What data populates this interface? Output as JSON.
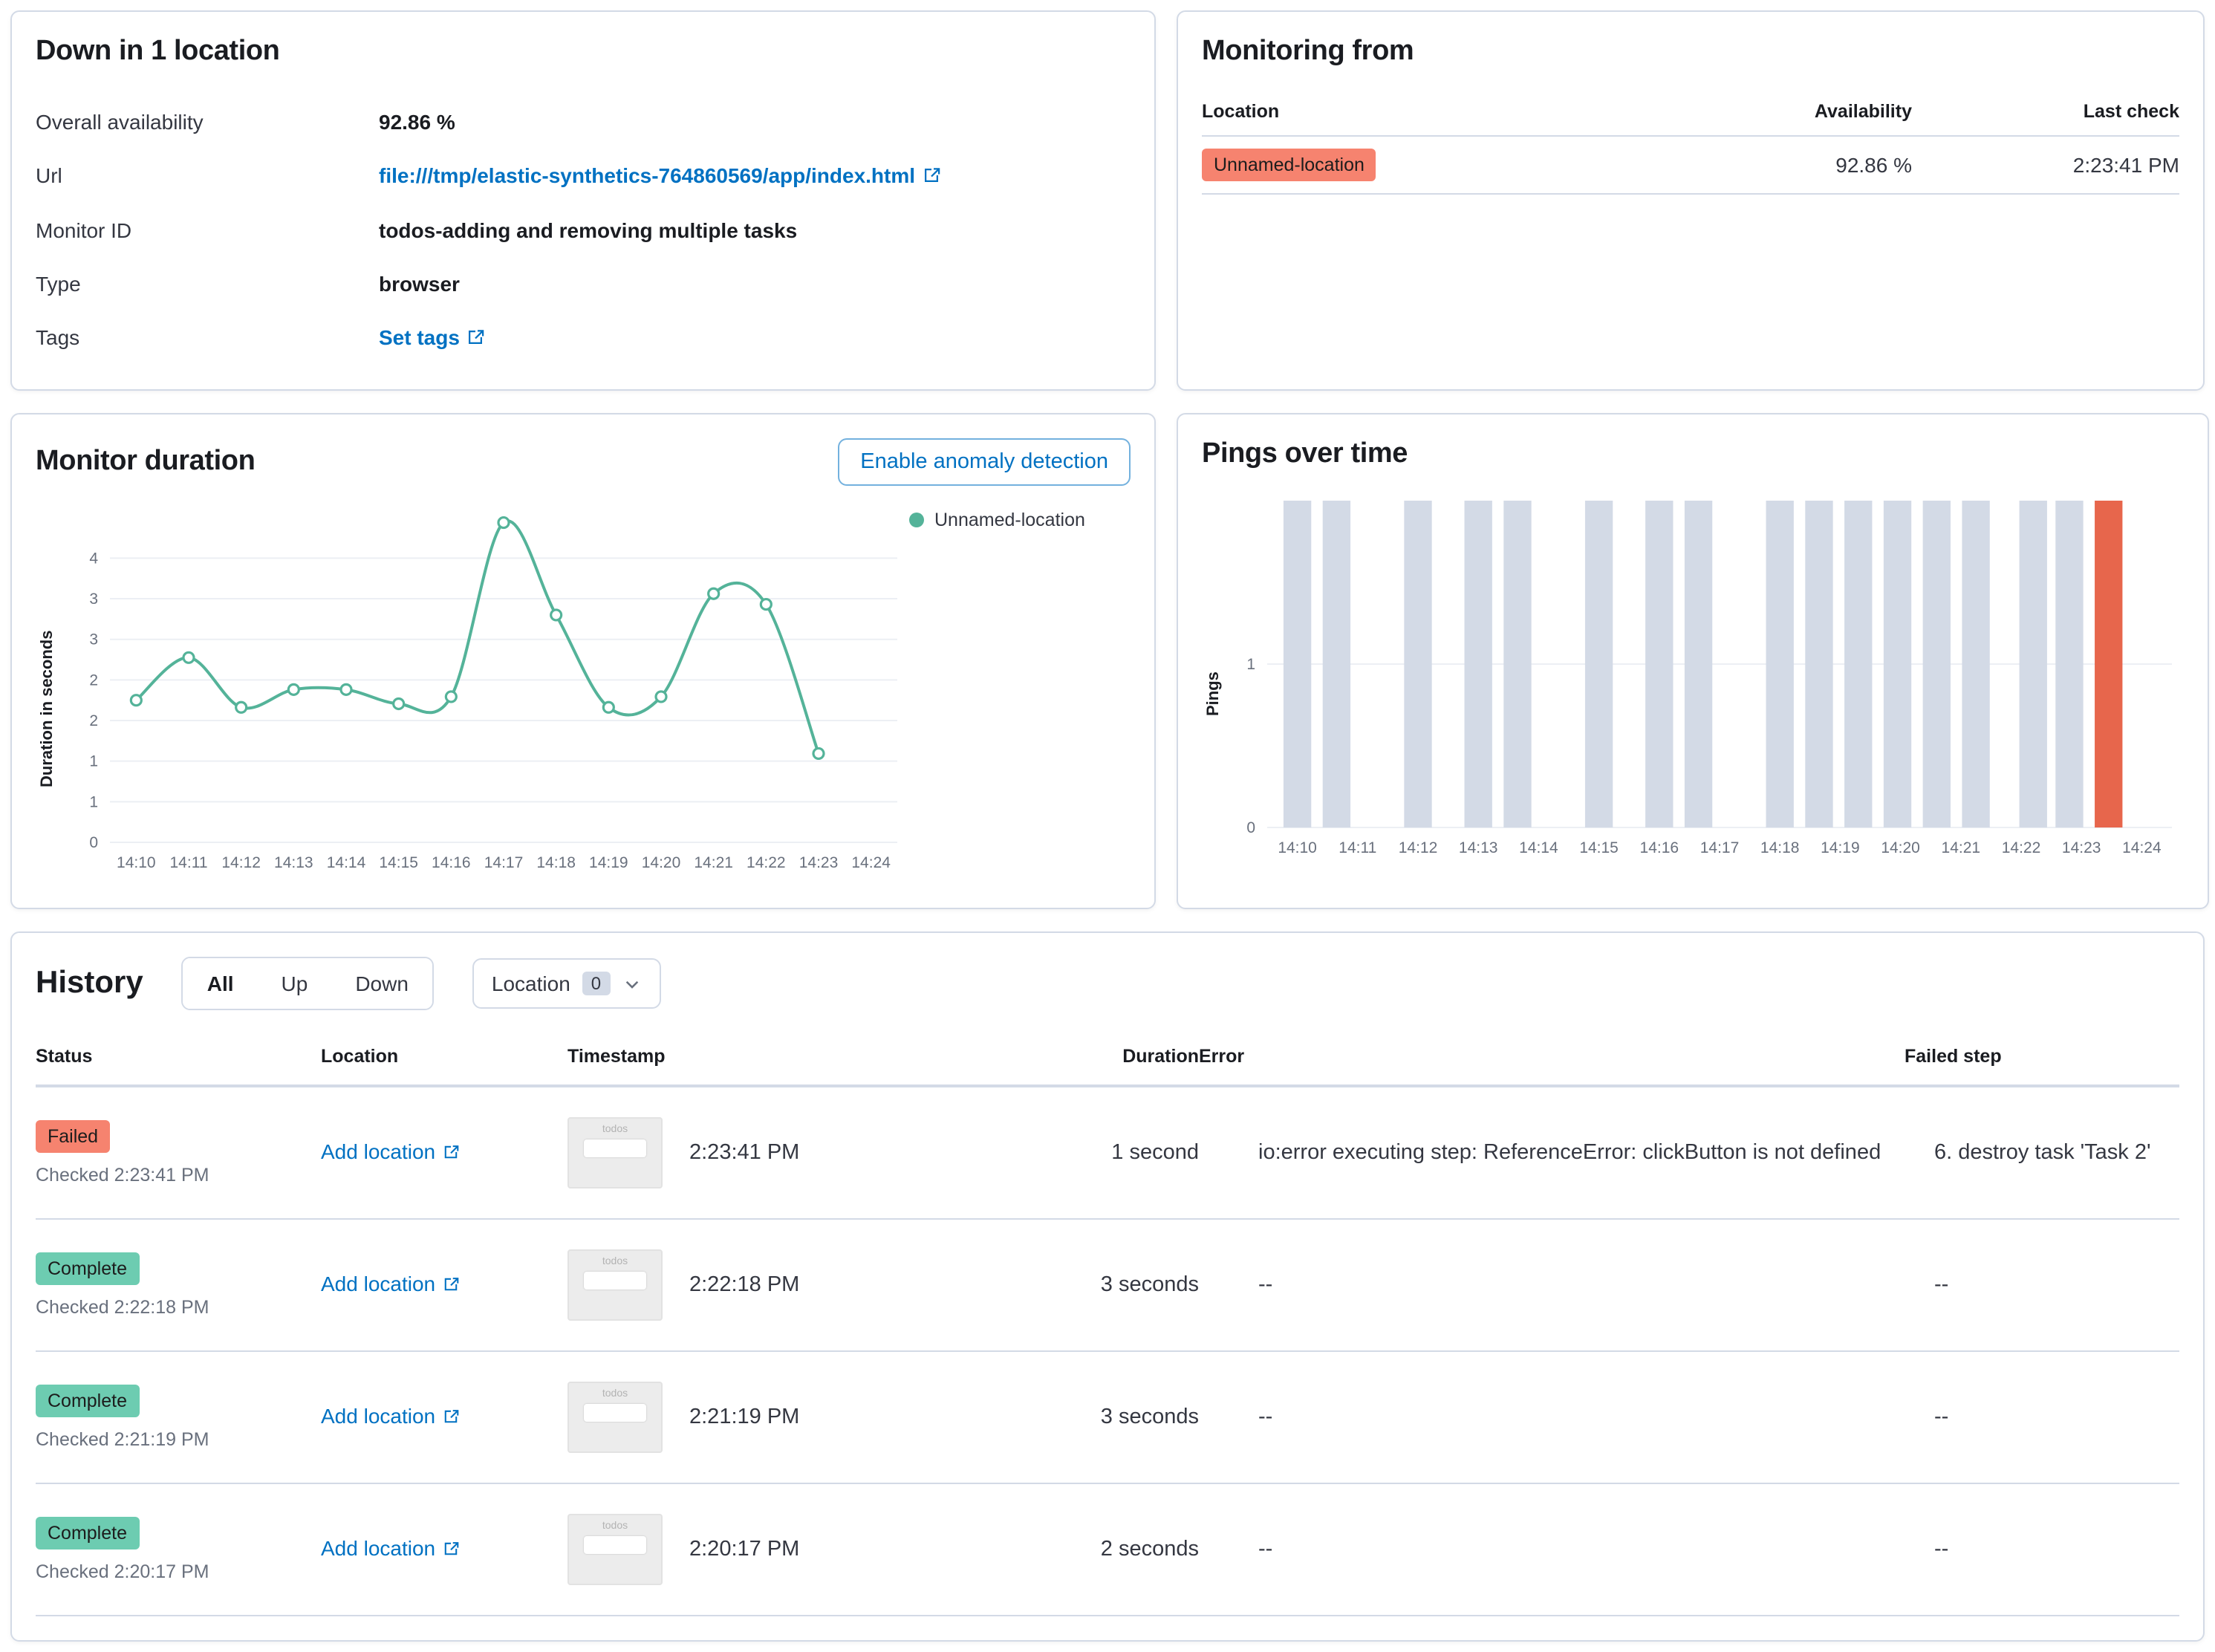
{
  "colors": {
    "link_blue": "#0071c2",
    "danger_badge": "#f6836f",
    "success_badge": "#6dccb1",
    "bar_up": "#d3dae6",
    "bar_down": "#e7664c",
    "duration_line": "#54b399"
  },
  "status_panel": {
    "title": "Down in 1 location",
    "rows": [
      {
        "label": "Overall availability",
        "value": "92.86 %"
      },
      {
        "label": "Url",
        "value": "file:///tmp/elastic-synthetics-764860569/app/index.html"
      },
      {
        "label": "Monitor ID",
        "value": "todos-adding and removing multiple tasks"
      },
      {
        "label": "Type",
        "value": "browser"
      },
      {
        "label": "Tags",
        "value": "Set tags"
      }
    ]
  },
  "monitoring_from": {
    "title": "Monitoring from",
    "columns": {
      "location": "Location",
      "availability": "Availability",
      "last_check": "Last check"
    },
    "rows": [
      {
        "location": "Unnamed-location",
        "status_kind": "danger",
        "availability": "92.86 %",
        "last_check": "2:23:41 PM"
      }
    ]
  },
  "duration_panel": {
    "title": "Monitor duration",
    "anomaly_button": "Enable anomaly detection",
    "legend": "Unnamed-location",
    "ylabel": "Duration in seconds"
  },
  "pings_panel": {
    "title": "Pings over time",
    "ylabel": "Pings"
  },
  "history": {
    "title": "History",
    "filter_all": "All",
    "filter_up": "Up",
    "filter_down": "Down",
    "location_filter": "Location",
    "location_count": "0",
    "columns": {
      "status": "Status",
      "location": "Location",
      "timestamp": "Timestamp",
      "duration": "Duration",
      "error": "Error",
      "failed_step": "Failed step"
    },
    "rows": [
      {
        "status": "Failed",
        "status_kind": "danger",
        "checked": "Checked 2:23:41 PM",
        "location": "Add location",
        "thumb_label": "todos",
        "timestamp": "2:23:41 PM",
        "duration": "1 second",
        "error": "io:error executing step: ReferenceError: clickButton is not defined",
        "failed_step": "6. destroy task 'Task 2'"
      },
      {
        "status": "Complete",
        "status_kind": "success",
        "checked": "Checked 2:22:18 PM",
        "location": "Add location",
        "thumb_label": "todos",
        "timestamp": "2:22:18 PM",
        "duration": "3 seconds",
        "error": "--",
        "failed_step": "--"
      },
      {
        "status": "Complete",
        "status_kind": "success",
        "checked": "Checked 2:21:19 PM",
        "location": "Add location",
        "thumb_label": "todos",
        "timestamp": "2:21:19 PM",
        "duration": "3 seconds",
        "error": "--",
        "failed_step": "--"
      },
      {
        "status": "Complete",
        "status_kind": "success",
        "checked": "Checked 2:20:17 PM",
        "location": "Add location",
        "thumb_label": "todos",
        "timestamp": "2:20:17 PM",
        "duration": "2 seconds",
        "error": "--",
        "failed_step": "--"
      }
    ]
  },
  "chart_data": [
    {
      "type": "line",
      "title": "Monitor duration",
      "ylabel": "Duration in seconds",
      "series": [
        {
          "name": "Unnamed-location",
          "values": [
            2.0,
            2.6,
            1.9,
            2.15,
            2.15,
            1.95,
            2.05,
            4.5,
            3.2,
            1.9,
            2.05,
            3.5,
            3.35,
            1.25
          ]
        }
      ],
      "x": [
        "14:10",
        "14:11",
        "14:12",
        "14:13",
        "14:14",
        "14:15",
        "14:16",
        "14:17",
        "14:18",
        "14:19",
        "14:20",
        "14:21",
        "14:22",
        "14:23"
      ],
      "x_ticks": [
        "14:10",
        "14:11",
        "14:12",
        "14:13",
        "14:14",
        "14:15",
        "14:16",
        "14:17",
        "14:18",
        "14:19",
        "14:20",
        "14:21",
        "14:22",
        "14:23",
        "14:24"
      ],
      "y_tick_labels": [
        "0",
        "1",
        "1",
        "2",
        "2",
        "3",
        "3",
        "4"
      ],
      "ylim": [
        0,
        4.6
      ],
      "color": "#54b399",
      "grid": true,
      "legend_position": "right"
    },
    {
      "type": "bar",
      "title": "Pings over time",
      "ylabel": "Pings",
      "x_ticks": [
        "14:10",
        "14:11",
        "14:12",
        "14:13",
        "14:14",
        "14:15",
        "14:16",
        "14:17",
        "14:18",
        "14:19",
        "14:20",
        "14:21",
        "14:22",
        "14:23",
        "14:24"
      ],
      "x_start": "14:10",
      "y_ticks": [
        {
          "value": 0,
          "label": "0"
        },
        {
          "value": 1,
          "label": "1"
        }
      ],
      "ylim": [
        0,
        2
      ],
      "colors": {
        "up": "#d3dae6",
        "down": "#e7664c"
      },
      "bars": [
        {
          "minutes_after_start": 0.0,
          "pings": 2,
          "status": "up"
        },
        {
          "minutes_after_start": 0.65,
          "pings": 2,
          "status": "up"
        },
        {
          "minutes_after_start": 2.0,
          "pings": 2,
          "status": "up"
        },
        {
          "minutes_after_start": 3.0,
          "pings": 2,
          "status": "up"
        },
        {
          "minutes_after_start": 3.65,
          "pings": 2,
          "status": "up"
        },
        {
          "minutes_after_start": 5.0,
          "pings": 2,
          "status": "up"
        },
        {
          "minutes_after_start": 6.0,
          "pings": 2,
          "status": "up"
        },
        {
          "minutes_after_start": 6.65,
          "pings": 2,
          "status": "up"
        },
        {
          "minutes_after_start": 8.0,
          "pings": 2,
          "status": "up"
        },
        {
          "minutes_after_start": 8.65,
          "pings": 2,
          "status": "up"
        },
        {
          "minutes_after_start": 9.3,
          "pings": 2,
          "status": "up"
        },
        {
          "minutes_after_start": 9.95,
          "pings": 2,
          "status": "up"
        },
        {
          "minutes_after_start": 10.6,
          "pings": 2,
          "status": "up"
        },
        {
          "minutes_after_start": 11.25,
          "pings": 2,
          "status": "up"
        },
        {
          "minutes_after_start": 12.2,
          "pings": 2,
          "status": "up"
        },
        {
          "minutes_after_start": 12.8,
          "pings": 2,
          "status": "up"
        },
        {
          "minutes_after_start": 13.45,
          "pings": 2,
          "status": "down"
        }
      ]
    }
  ]
}
